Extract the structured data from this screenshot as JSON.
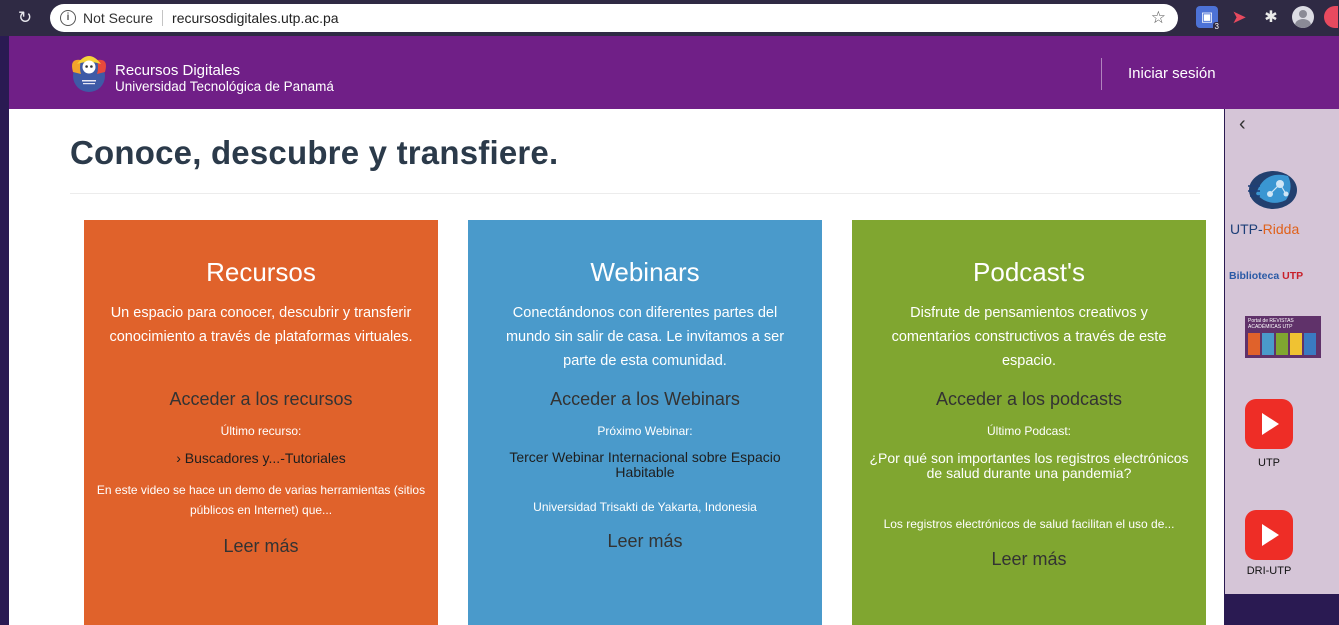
{
  "browser": {
    "security_label": "Not Secure",
    "url": "recursosdigitales.utp.ac.pa",
    "extension_badge": "3"
  },
  "header": {
    "brand_title": "Recursos Digitales",
    "brand_subtitle": "Universidad Tecnológica de Panamá",
    "login": "Iniciar sesión"
  },
  "page_title": "Conoce, descubre y transfiere.",
  "cards": [
    {
      "title": "Recursos",
      "description": "Un espacio para conocer, descubrir y transferir conocimiento a través de plataformas virtuales.",
      "link": "Acceder a los recursos",
      "latest_label": "Último recurso:",
      "latest_item": "›  Buscadores y...-Tutoriales",
      "excerpt": "En este video se hace un demo de varias herramientas (sitios públicos en Internet) que...",
      "read_more": "Leer más",
      "color": "#e0622b"
    },
    {
      "title": "Webinars",
      "description": "Conectándonos con diferentes partes del mundo sin salir de casa. Le invitamos a ser parte de esta comunidad.",
      "link": "Acceder a los Webinars",
      "latest_label": "Próximo Webinar:",
      "latest_item": "Tercer Webinar Internacional sobre Espacio Habitable",
      "excerpt": "Universidad Trisakti de Yakarta, Indonesia",
      "read_more": "Leer más",
      "color": "#4a9acb"
    },
    {
      "title": "Podcast's",
      "description": "Disfrute de pensamientos creativos y comentarios constructivos a través de este espacio.",
      "link": "Acceder a los podcasts",
      "latest_label": "Último Podcast:",
      "latest_item": "¿Por qué son importantes los registros electrónicos de salud durante una pandemia?",
      "excerpt": "Los registros electrónicos de salud facilitan el uso de...",
      "read_more": "Leer más",
      "color": "#80a630"
    }
  ],
  "sidebar": {
    "ridda_prefix": "UTP-",
    "ridda_suffix": "Ridda",
    "biblioteca_prefix": "Biblioteca ",
    "biblioteca_suffix": "UTP",
    "revistas_title": "Portal de REVISTAS ACADÉMICAS UTP",
    "youtube_utp": "UTP",
    "youtube_dri": "DRI-UTP"
  },
  "colors": {
    "header_purple": "#701f87",
    "sidebar_bg": "#d5c5d7",
    "title_text": "#2b3a4a",
    "youtube_red": "#ee2d26"
  }
}
